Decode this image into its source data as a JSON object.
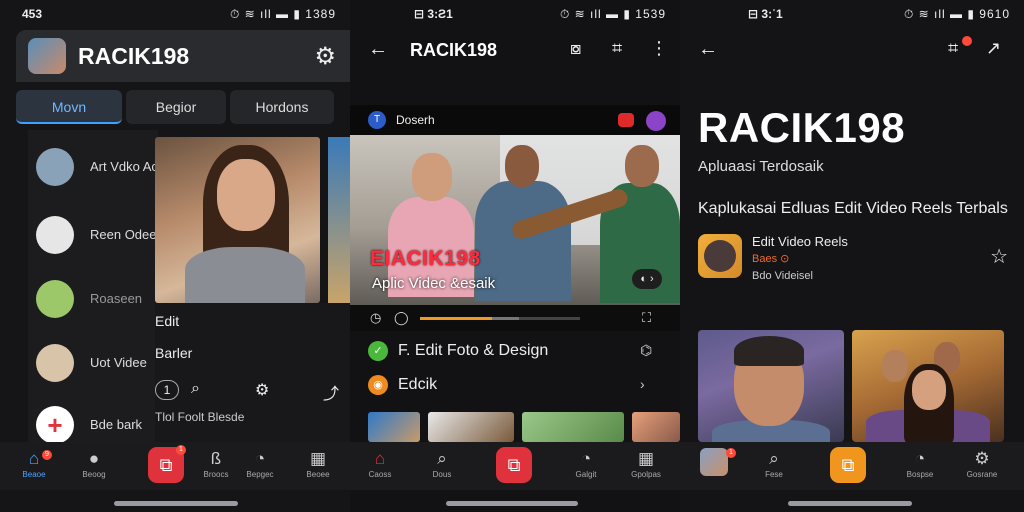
{
  "screens": [
    {
      "status": {
        "time": "453",
        "icons": "⏱ ≋ ıll ▬ ▮ 1389"
      },
      "header": {
        "title": "RACIK198"
      },
      "tabs": [
        {
          "label": "Movn",
          "active": true
        },
        {
          "label": "Begior",
          "active": false
        },
        {
          "label": "Hordons",
          "active": false
        }
      ],
      "list": [
        {
          "label": "Art Vdko Ac"
        },
        {
          "label": "Reen Odee"
        },
        {
          "label": "Roaseen"
        },
        {
          "label": "Uot Videe"
        },
        {
          "label": "Bde bark"
        }
      ],
      "panel": {
        "line1": "Edit",
        "line2": "Barler",
        "count": "1",
        "footer": "Tlol Foolt Blesde"
      },
      "nav": [
        {
          "label": "Beaoe",
          "icon": "home-icon",
          "badge": "9",
          "active": true
        },
        {
          "label": "Beoog",
          "icon": "pin-icon",
          "badge": "",
          "active": false
        },
        {
          "label": "",
          "icon": "create-icon",
          "badge": "1",
          "active": false,
          "center": true
        },
        {
          "label": "Broocs",
          "icon": "bookmark-icon",
          "badge": "",
          "active": false
        },
        {
          "label": "Bepgec",
          "icon": "timer-icon",
          "badge": "",
          "active": false
        },
        {
          "label": "Beoee",
          "icon": "grid-icon",
          "badge": "",
          "active": false
        }
      ]
    },
    {
      "status": {
        "time": "⊟ 3:Ƨ1",
        "icons": "⏱ ≋ ıll ▬ ▮ 1539"
      },
      "header": {
        "title": "RACIK198"
      },
      "channel": {
        "chip": "T",
        "name": "Doserh"
      },
      "video": {
        "caption_title": "EIACIK198",
        "caption_sub": "Aplic Videc &esaik",
        "pill": "◐ ›"
      },
      "progress": {
        "played": 0.45,
        "buffered": 0.62
      },
      "rows": [
        {
          "label": "F. Edit Foto & Design",
          "end": "⌬",
          "color": "#4ab83c",
          "mark": "✓"
        },
        {
          "label": "Edcik",
          "end": "›",
          "color": "#f08a1e",
          "mark": "◉"
        }
      ],
      "nav": [
        {
          "label": "Caoss",
          "icon": "home-icon",
          "active": false
        },
        {
          "label": "Dous",
          "icon": "search-icon",
          "active": false
        },
        {
          "label": "",
          "icon": "create-icon",
          "active": false,
          "center": true
        },
        {
          "label": "Galgit",
          "icon": "timer-icon",
          "active": false
        },
        {
          "label": "Gpolpas",
          "icon": "grid-icon",
          "active": false
        }
      ]
    },
    {
      "status": {
        "time": "⊟ 3:ʿ1",
        "icons": "⏱ ≋ ıll ▬ ▮ 9610"
      },
      "title": "RACIK198",
      "subtitle": "Apluaasi Terdosaik",
      "description": "Kaplukasai Edluas Edit Video Reels Terbals",
      "app": {
        "name": "Edit Video Reels",
        "rating": "Baes ⊙",
        "detail": "Bdo Videisel"
      },
      "nav": [
        {
          "label": "",
          "icon": "avatar-icon",
          "badge": "1",
          "active": false
        },
        {
          "label": "Fese",
          "icon": "search-icon",
          "active": false
        },
        {
          "label": "",
          "icon": "create-icon",
          "active": true,
          "center": true
        },
        {
          "label": "Bospse",
          "icon": "timer-icon",
          "active": false
        },
        {
          "label": "Gosrane",
          "icon": "settings-icon",
          "active": false
        }
      ]
    }
  ],
  "colors": {
    "accent": "#3ea0ff",
    "record": "#e0323c",
    "orange": "#f29a1f"
  }
}
